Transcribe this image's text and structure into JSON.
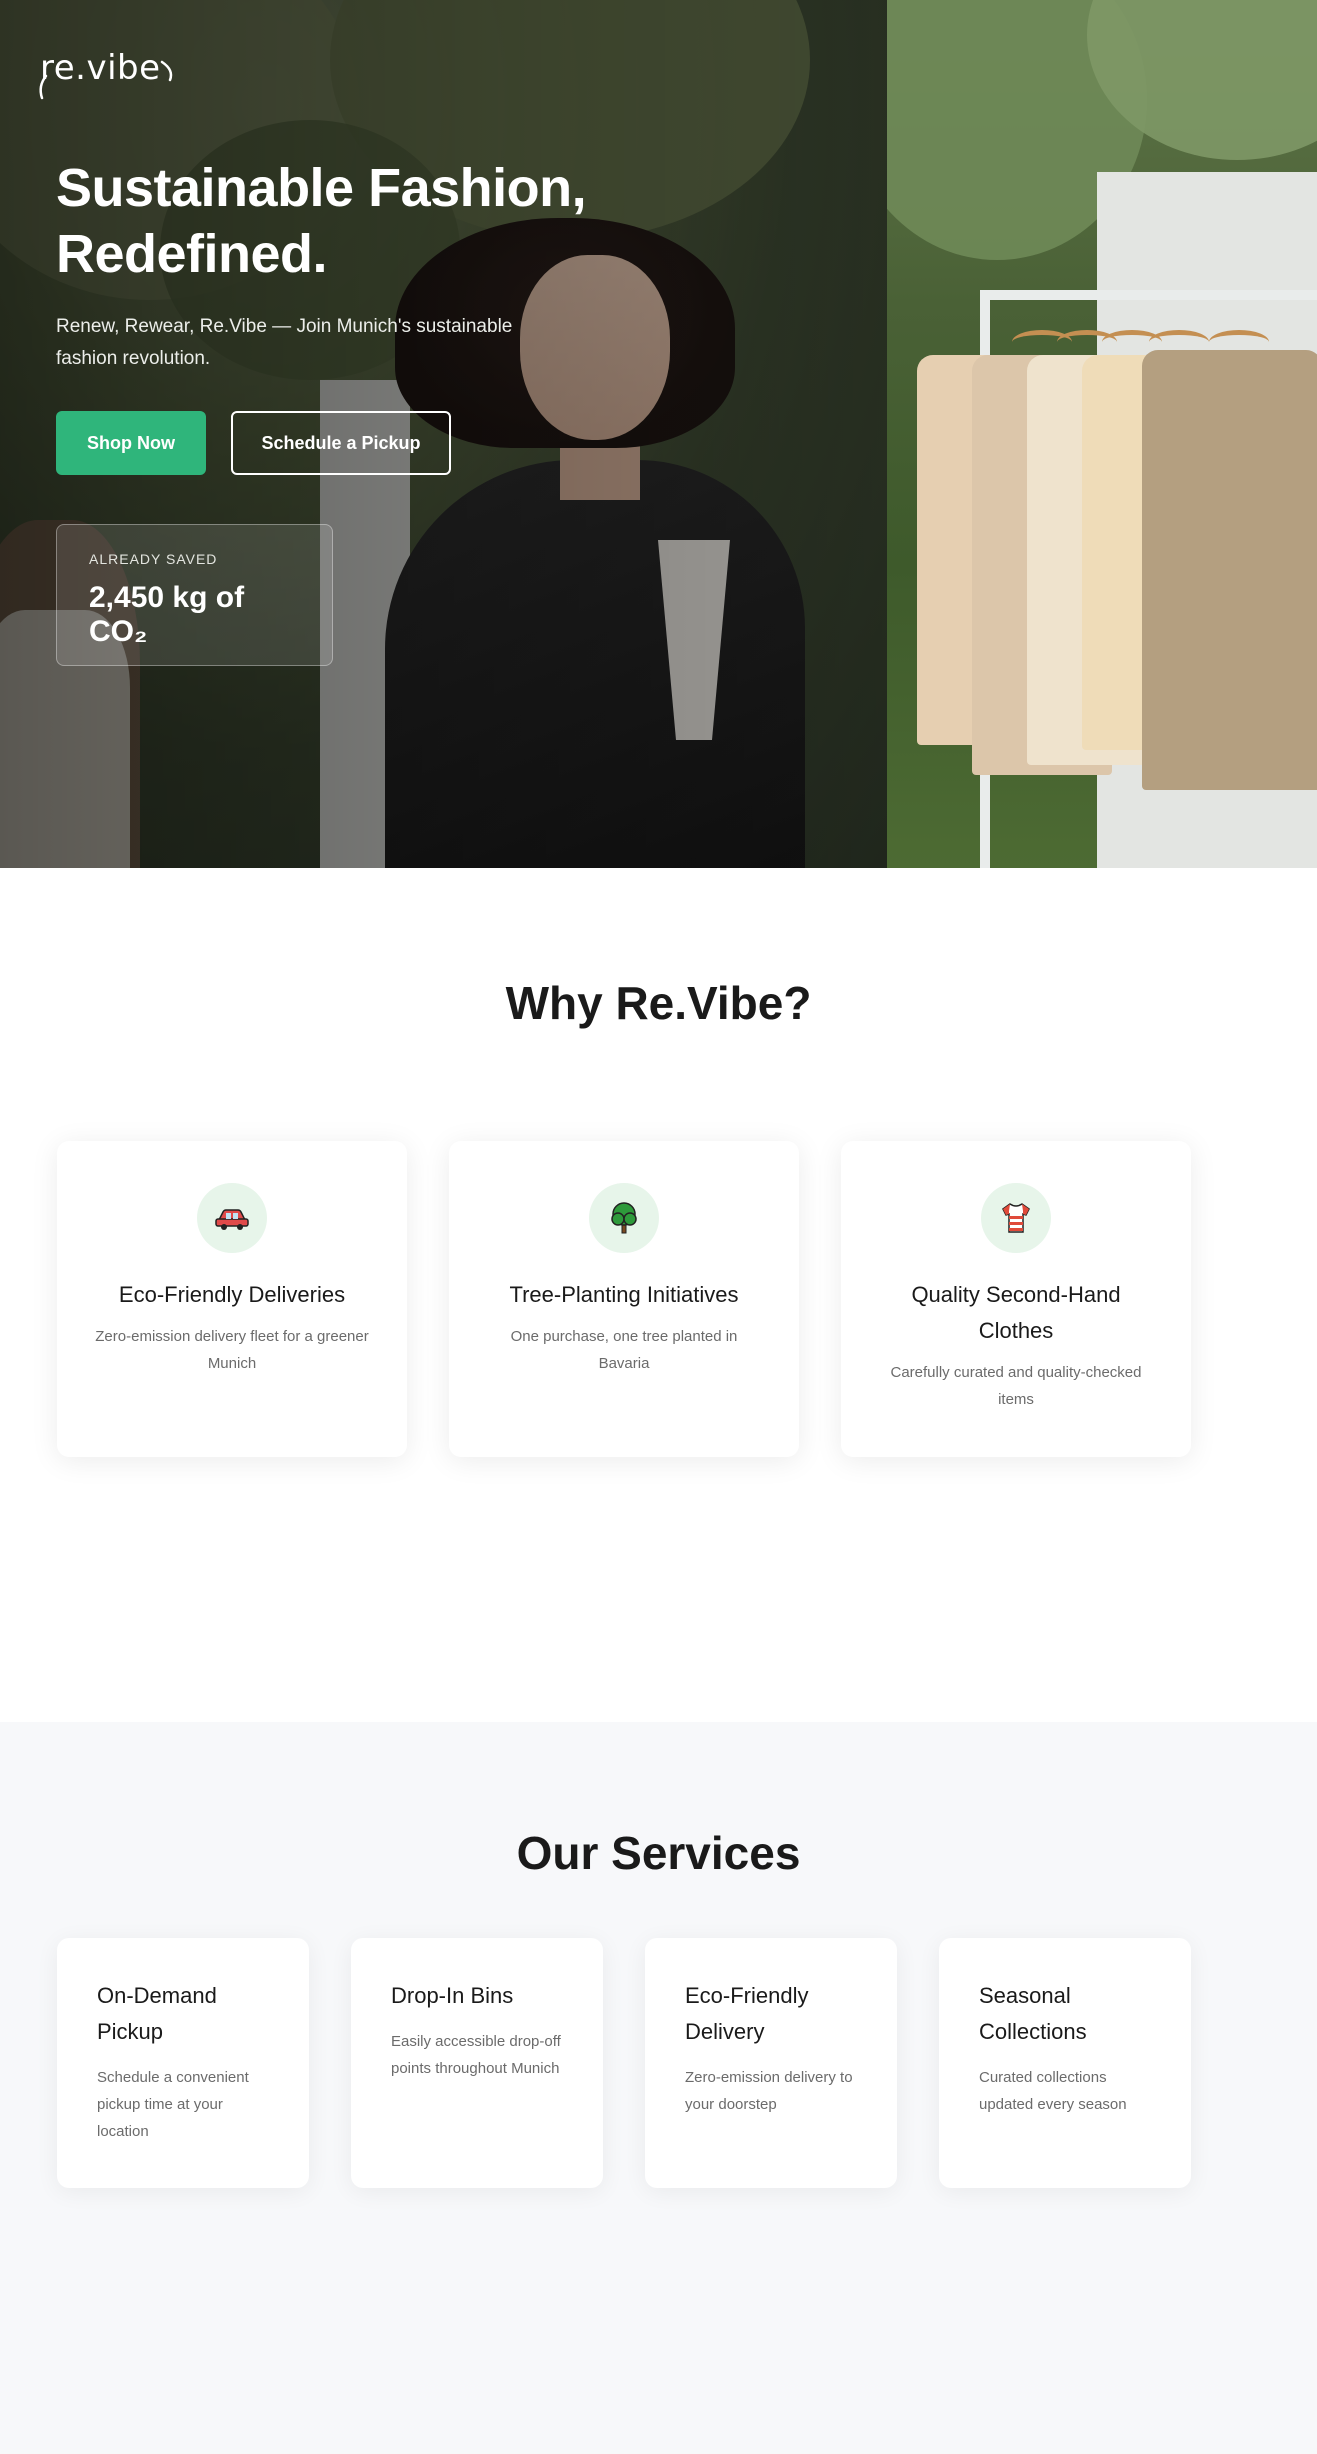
{
  "hero": {
    "logo": "re.vibe",
    "title_line1": "Sustainable Fashion,",
    "title_line2": "Redefined.",
    "subtitle": "Renew, Rewear, Re.Vibe — Join Munich's sustainable fashion revolution.",
    "primary_button": "Shop Now",
    "secondary_button": "Schedule a Pickup",
    "stat_label": "Already Saved",
    "stat_value": "2,450 kg of CO₂"
  },
  "why": {
    "title": "Why Re.Vibe?",
    "cards": [
      {
        "icon": "car-icon",
        "title": "Eco-Friendly Deliveries",
        "text": "Zero-emission delivery fleet for a greener Munich"
      },
      {
        "icon": "tree-icon",
        "title": "Tree-Planting Initiatives",
        "text": "One purchase, one tree planted in Bavaria"
      },
      {
        "icon": "shirt-icon",
        "title": "Quality Second-Hand Clothes",
        "text": "Carefully curated and quality-checked items"
      }
    ]
  },
  "services": {
    "title": "Our Services",
    "cards": [
      {
        "title": "On-Demand Pickup",
        "text": "Schedule a convenient pickup time at your location"
      },
      {
        "title": "Drop-In Bins",
        "text": "Easily accessible drop-off points throughout Munich"
      },
      {
        "title": "Eco-Friendly Delivery",
        "text": "Zero-emission delivery to your doorstep"
      },
      {
        "title": "Seasonal Collections",
        "text": "Curated collections updated every season"
      }
    ]
  },
  "colors": {
    "accent": "#2fb57b",
    "icon_bg": "#e7f5ea",
    "services_bg": "#f7f8fa"
  }
}
